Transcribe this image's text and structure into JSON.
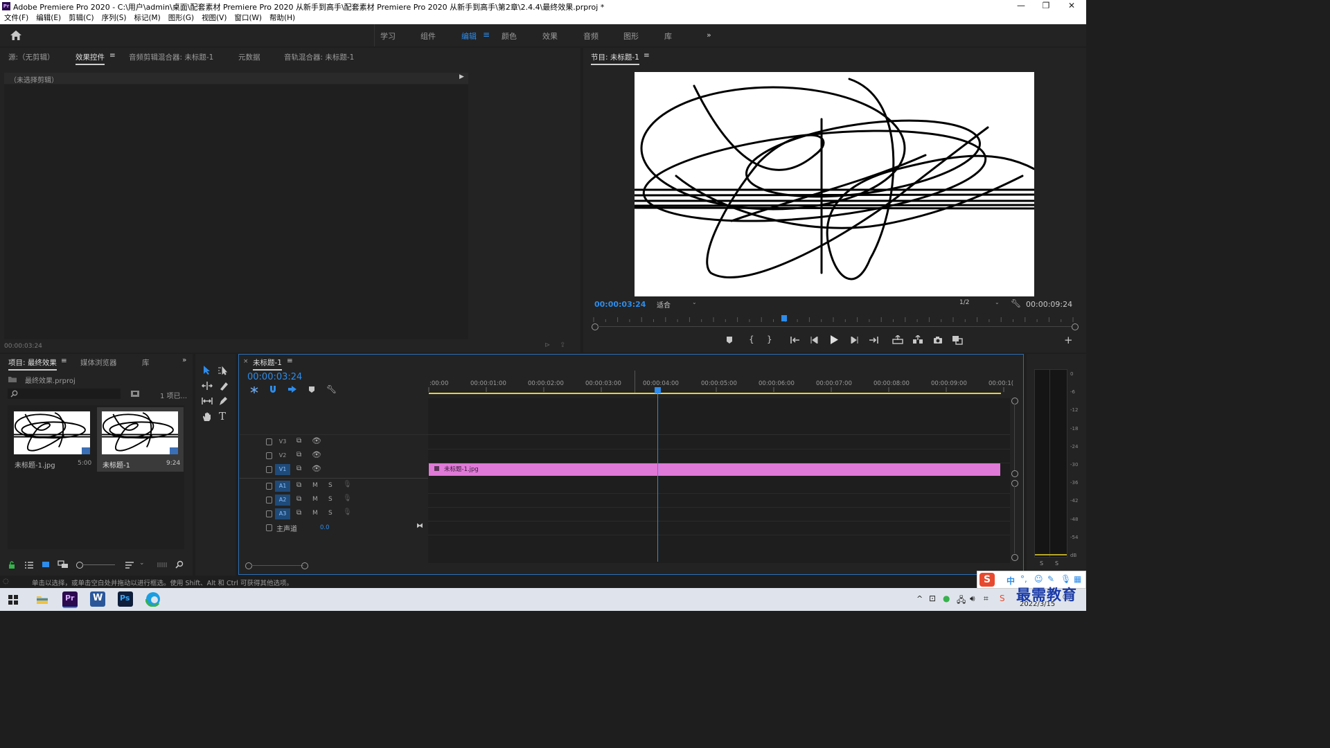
{
  "app": {
    "logo": "Pr",
    "title": "Adobe Premiere Pro 2020 - C:\\用户\\admin\\桌面\\配套素材 Premiere Pro 2020 从新手到高手\\配套素材 Premiere Pro 2020 从新手到高手\\第2章\\2.4.4\\最终效果.prproj *"
  },
  "menu": [
    "文件(F)",
    "编辑(E)",
    "剪辑(C)",
    "序列(S)",
    "标记(M)",
    "图形(G)",
    "视图(V)",
    "窗口(W)",
    "帮助(H)"
  ],
  "workspaces": {
    "items": [
      "学习",
      "组件",
      "编辑",
      "颜色",
      "效果",
      "音频",
      "图形",
      "库"
    ],
    "active": "编辑"
  },
  "source_panel": {
    "tabs": [
      "源:（无剪辑）",
      "效果控件",
      "音频剪辑混合器: 未标题-1",
      "元数据",
      "音轨混合器: 未标题-1"
    ],
    "active_tab": "效果控件",
    "no_clip": "（未选择剪辑）",
    "timecode": "00:00:03:24"
  },
  "program_monitor": {
    "title": "节目: 未标题-1",
    "current_time": "00:00:03:24",
    "zoom": "适合",
    "resolution": "1/2",
    "duration": "00:00:09:24",
    "playhead_fraction": 0.4
  },
  "project_panel": {
    "tabs": [
      "项目: 最终效果",
      "媒体浏览器",
      "库"
    ],
    "file": "最终效果.prproj",
    "item_count": "1 项已...",
    "items": [
      {
        "name": "未标题-1.jpg",
        "duration": "5:00"
      },
      {
        "name": "未标题-1",
        "duration": "9:24"
      }
    ]
  },
  "timeline": {
    "sequence": "未标题-1",
    "timecode": "00:00:03:24",
    "ruler": [
      ":00:00",
      "00:00:01:00",
      "00:00:02:00",
      "00:00:03:00",
      "00:00:04:00",
      "00:00:05:00",
      "00:00:06:00",
      "00:00:07:00",
      "00:00:08:00",
      "00:00:09:00",
      "00:00:1("
    ],
    "tracks": [
      {
        "name": "V3",
        "type": "video",
        "active": false
      },
      {
        "name": "V2",
        "type": "video",
        "active": false
      },
      {
        "name": "V1",
        "type": "video",
        "active": true
      },
      {
        "name": "A1",
        "type": "audio",
        "active": true
      },
      {
        "name": "A2",
        "type": "audio",
        "active": true
      },
      {
        "name": "A3",
        "type": "audio",
        "active": true
      }
    ],
    "mute_label": "M",
    "solo_label": "S",
    "master": {
      "label": "主声道",
      "value": "0.0"
    },
    "clip": {
      "name": "未标题-1.jpg",
      "color": "#e07ad8"
    },
    "playhead_seconds": 3.96
  },
  "meter": {
    "labels": [
      "0",
      "-6",
      "-12",
      "-18",
      "-24",
      "-30",
      "-36",
      "-42",
      "-48",
      "-54",
      "dB"
    ],
    "solo_buttons": [
      "S",
      "S"
    ]
  },
  "status": {
    "hint": "单击以选择，或单击空白处并拖动以进行框选。使用 Shift、Alt 和 Ctrl 可获得其他选项。"
  },
  "taskbar": {
    "ime": "中",
    "watermark": "最需教育",
    "date": "2022/3/15"
  },
  "colors": {
    "accent": "#2d8ceb",
    "clip": "#e07ad8",
    "panel": "#232323",
    "background": "#1e1e1e",
    "work_area": "#e8d13b"
  }
}
